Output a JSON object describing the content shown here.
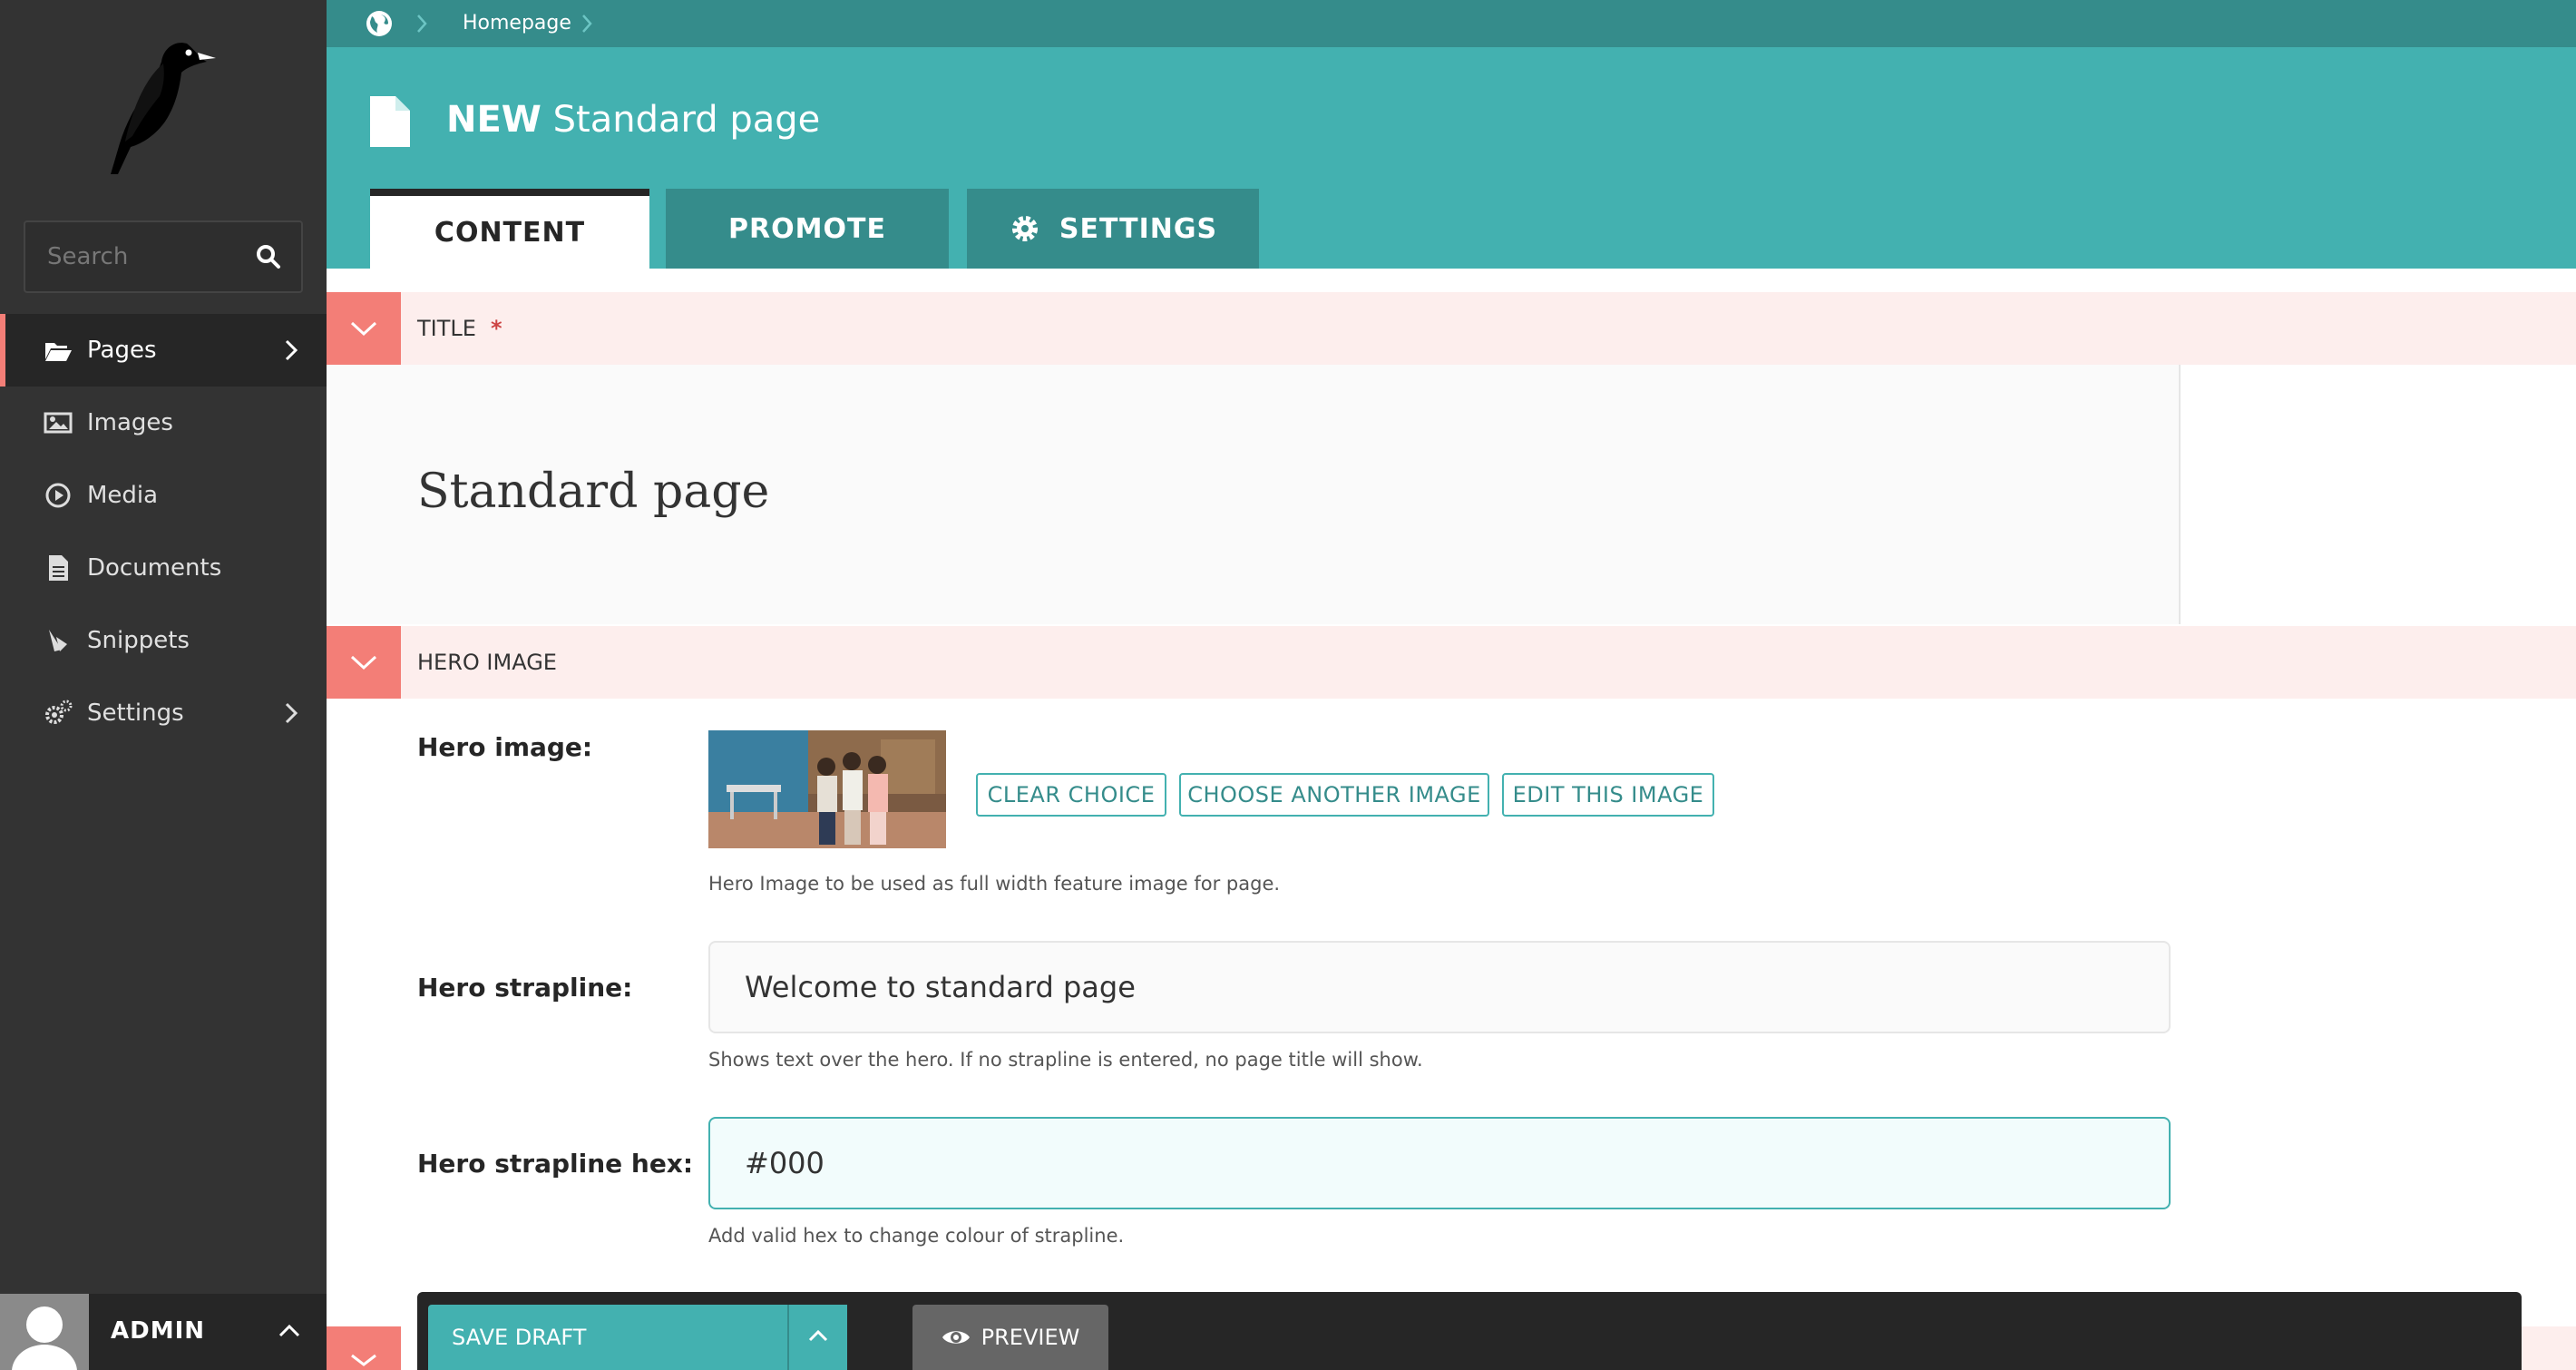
{
  "sidebar": {
    "search_placeholder": "Search",
    "items": [
      {
        "label": "Pages",
        "icon": "folder-open-icon"
      },
      {
        "label": "Images",
        "icon": "image-icon"
      },
      {
        "label": "Media",
        "icon": "media-icon"
      },
      {
        "label": "Documents",
        "icon": "doc-icon"
      },
      {
        "label": "Snippets",
        "icon": "snippet-icon"
      },
      {
        "label": "Settings",
        "icon": "cogs-icon"
      }
    ],
    "account_name": "ADMIN"
  },
  "breadcrumb": {
    "items": [
      "Homepage"
    ]
  },
  "header": {
    "title_prefix": "NEW",
    "title": "Standard page",
    "tabs": [
      {
        "label": "CONTENT",
        "active": true
      },
      {
        "label": "PROMOTE",
        "active": false
      },
      {
        "label": "SETTINGS",
        "active": false
      }
    ]
  },
  "sections": {
    "title": {
      "label": "TITLE",
      "required_mark": "*",
      "value": "Standard page"
    },
    "hero": {
      "label": "HERO IMAGE",
      "image_label": "Hero image:",
      "buttons": [
        "CLEAR CHOICE",
        "CHOOSE ANOTHER IMAGE",
        "EDIT THIS IMAGE"
      ],
      "image_help": "Hero Image to be used as full width feature image for page.",
      "strapline_label": "Hero strapline:",
      "strapline_value": "Welcome to standard page",
      "strapline_help": "Shows text over the hero. If no strapline is entered, no page title will show.",
      "hex_label": "Hero strapline hex:",
      "hex_value": "#000",
      "hex_help": "Add valid hex to change colour of strapline."
    }
  },
  "footer": {
    "save_label": "SAVE DRAFT",
    "preview_label": "PREVIEW"
  },
  "colors": {
    "sidebar": "#333333",
    "teal": "#43b1b0",
    "teal_dark": "#358c8b",
    "salmon": "#f37e77",
    "section_bg": "#fdeeed"
  }
}
